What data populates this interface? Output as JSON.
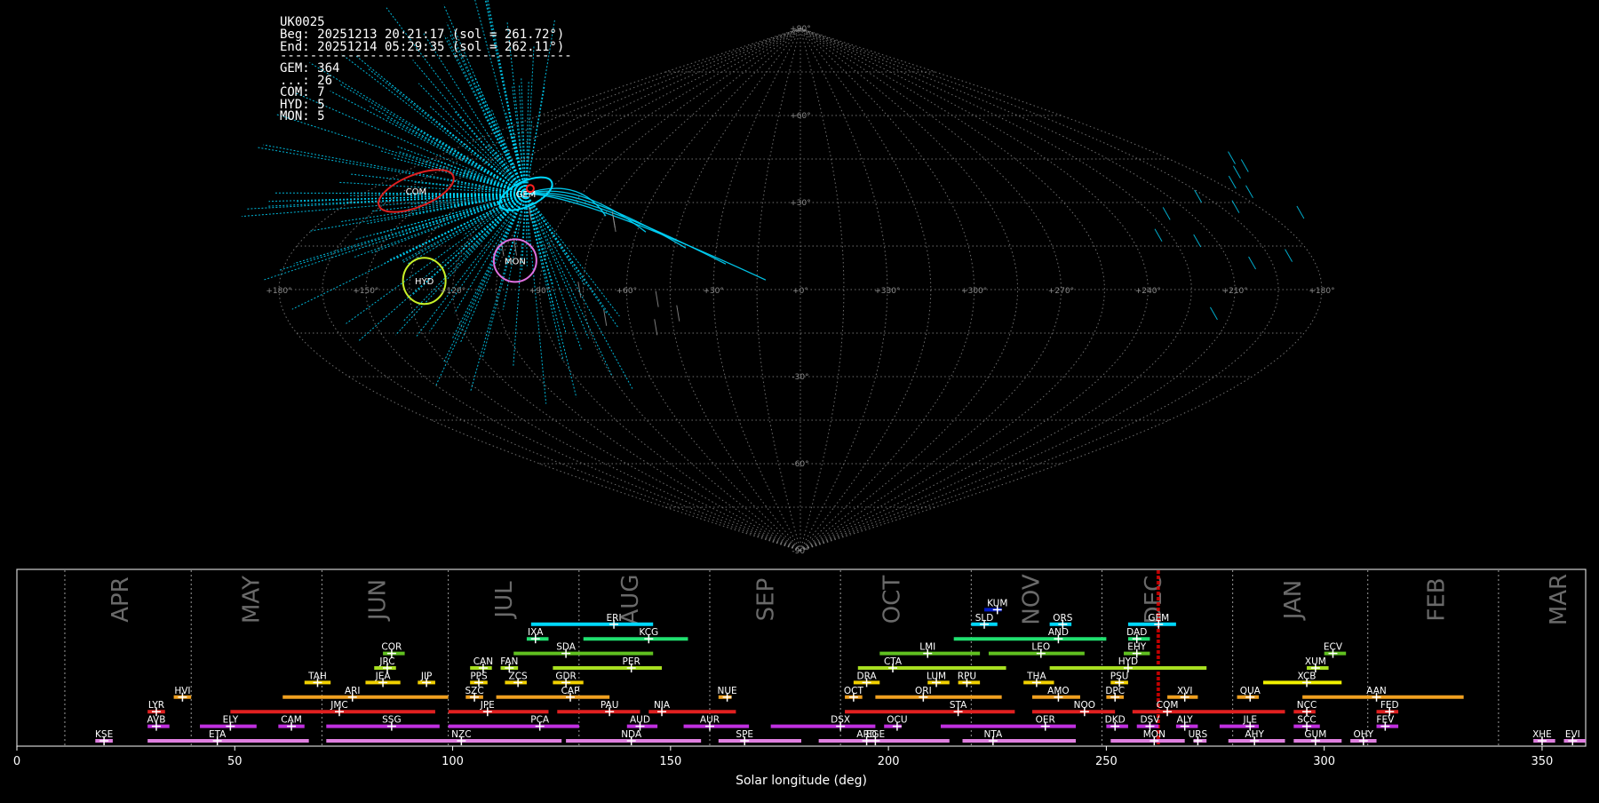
{
  "info": {
    "station": "UK0025",
    "beg": "Beg: 20251213 20:21:17 (sol = 261.72°)",
    "end": "End: 20251214 05:29:35 (sol = 262.11°)",
    "rule": "---------------------------------------",
    "counts": [
      "GEM: 364",
      "...: 26",
      "COM: 7",
      "HYD: 5",
      "MON: 5"
    ]
  },
  "sky_map": {
    "projection": "sinusoidal",
    "lon_ticks": [
      {
        "lon": 180,
        "label": "+180°"
      },
      {
        "lon": 150,
        "label": "+150°"
      },
      {
        "lon": 120,
        "label": "+120°"
      },
      {
        "lon": 90,
        "label": "+90°"
      },
      {
        "lon": 60,
        "label": "+60°"
      },
      {
        "lon": 30,
        "label": "+30°"
      },
      {
        "lon": 0,
        "label": "+0°"
      },
      {
        "lon": -30,
        "label": "+330°"
      },
      {
        "lon": -60,
        "label": "+300°"
      },
      {
        "lon": -90,
        "label": "+270°"
      },
      {
        "lon": -120,
        "label": "+240°"
      },
      {
        "lon": -150,
        "label": "+210°"
      },
      {
        "lon": -180,
        "label": "+180°"
      }
    ],
    "lat_ticks": [
      {
        "lat": 90,
        "label": "+90°"
      },
      {
        "lat": 60,
        "label": "+60°"
      },
      {
        "lat": 30,
        "label": "+30°"
      },
      {
        "lat": -30,
        "label": "-30°"
      },
      {
        "lat": -60,
        "label": "-60°"
      },
      {
        "lat": -90,
        "label": "-90°"
      }
    ],
    "radiants": [
      {
        "code": "GEM",
        "lon": 113,
        "lat": 33,
        "color": "#00d8ff"
      },
      {
        "code": "COM",
        "lon": 160,
        "lat": 34,
        "color": "#e02020"
      },
      {
        "code": "HYD",
        "lon": 130,
        "lat": 3,
        "color": "#c8f028"
      },
      {
        "code": "MON",
        "lon": 100,
        "lat": 10,
        "color": "#e070e0"
      }
    ],
    "colors": {
      "meteor": "#00d8ff",
      "grid": "#8a8a8a",
      "sporadic": "#9a9a9a",
      "flash": "#ff2020"
    }
  },
  "chart_data": {
    "type": "timeline",
    "xlabel": "Solar longitude (deg)",
    "xlim": [
      0,
      360
    ],
    "xticks": [
      0,
      50,
      100,
      150,
      200,
      250,
      300,
      350
    ],
    "month_boundaries": [
      11,
      40,
      70,
      99,
      129,
      159,
      189,
      219,
      249,
      279,
      310,
      340
    ],
    "months": [
      {
        "label": "APR",
        "sol": 24
      },
      {
        "label": "MAY",
        "sol": 54
      },
      {
        "label": "JUN",
        "sol": 83
      },
      {
        "label": "JUL",
        "sol": 112
      },
      {
        "label": "AUG",
        "sol": 141
      },
      {
        "label": "SEP",
        "sol": 172
      },
      {
        "label": "OCT",
        "sol": 201
      },
      {
        "label": "NOV",
        "sol": 233
      },
      {
        "label": "DEC",
        "sol": 261
      },
      {
        "label": "JAN",
        "sol": 293
      },
      {
        "label": "FEB",
        "sol": 326
      },
      {
        "label": "MAR",
        "sol": 354
      }
    ],
    "current_sol": [
      261.72,
      262.11
    ],
    "current_color": "#e00000",
    "showers": [
      {
        "code": "KUM",
        "start": 222,
        "end": 226,
        "peak": 225,
        "row": 10,
        "color": "#0018c8"
      },
      {
        "code": "ERI",
        "start": 118,
        "end": 146,
        "peak": 137,
        "row": 9,
        "color": "#00d8ff"
      },
      {
        "code": "SLD",
        "start": 219,
        "end": 225,
        "peak": 222,
        "row": 9,
        "color": "#00d8ff"
      },
      {
        "code": "ORS",
        "start": 237,
        "end": 242,
        "peak": 240,
        "row": 9,
        "color": "#00d8ff"
      },
      {
        "code": "GEM",
        "start": 255,
        "end": 266,
        "peak": 262,
        "row": 9,
        "color": "#00d8ff"
      },
      {
        "code": "IXA",
        "start": 117,
        "end": 122,
        "peak": 119,
        "row": 8,
        "color": "#20e070"
      },
      {
        "code": "KCG",
        "start": 130,
        "end": 154,
        "peak": 145,
        "row": 8,
        "color": "#20e070"
      },
      {
        "code": "AND",
        "start": 215,
        "end": 250,
        "peak": 239,
        "row": 8,
        "color": "#20e070"
      },
      {
        "code": "DAD",
        "start": 255,
        "end": 260,
        "peak": 257,
        "row": 8,
        "color": "#20e070"
      },
      {
        "code": "COR",
        "start": 84,
        "end": 89,
        "peak": 86,
        "row": 7,
        "color": "#60c020"
      },
      {
        "code": "SDA",
        "start": 114,
        "end": 146,
        "peak": 126,
        "row": 7,
        "color": "#60c020"
      },
      {
        "code": "LMI",
        "start": 198,
        "end": 221,
        "peak": 209,
        "row": 7,
        "color": "#60c020"
      },
      {
        "code": "LEO",
        "start": 223,
        "end": 245,
        "peak": 235,
        "row": 7,
        "color": "#60c020"
      },
      {
        "code": "EHY",
        "start": 254,
        "end": 260,
        "peak": 257,
        "row": 7,
        "color": "#60c020"
      },
      {
        "code": "ECV",
        "start": 300,
        "end": 305,
        "peak": 302,
        "row": 7,
        "color": "#60c020"
      },
      {
        "code": "JRC",
        "start": 82,
        "end": 87,
        "peak": 85,
        "row": 6,
        "color": "#a8e020"
      },
      {
        "code": "CAN",
        "start": 104,
        "end": 109,
        "peak": 107,
        "row": 6,
        "color": "#a8e020"
      },
      {
        "code": "FAN",
        "start": 111,
        "end": 115,
        "peak": 113,
        "row": 6,
        "color": "#a8e020"
      },
      {
        "code": "PER",
        "start": 123,
        "end": 148,
        "peak": 141,
        "row": 6,
        "color": "#a8e020"
      },
      {
        "code": "CTA",
        "start": 193,
        "end": 227,
        "peak": 201,
        "row": 6,
        "color": "#a8e020"
      },
      {
        "code": "HYD",
        "start": 237,
        "end": 273,
        "peak": 255,
        "row": 6,
        "color": "#a8e020"
      },
      {
        "code": "XUM",
        "start": 296,
        "end": 301,
        "peak": 298,
        "row": 6,
        "color": "#a8e020"
      },
      {
        "code": "TAH",
        "start": 66,
        "end": 72,
        "peak": 69,
        "row": 5,
        "color": "#f0d000"
      },
      {
        "code": "JEA",
        "start": 80,
        "end": 88,
        "peak": 84,
        "row": 5,
        "color": "#f0d000"
      },
      {
        "code": "JIP",
        "start": 92,
        "end": 96,
        "peak": 94,
        "row": 5,
        "color": "#f0d000"
      },
      {
        "code": "PPS",
        "start": 104,
        "end": 108,
        "peak": 106,
        "row": 5,
        "color": "#f0d000"
      },
      {
        "code": "ZCS",
        "start": 112,
        "end": 117,
        "peak": 115,
        "row": 5,
        "color": "#f0d000"
      },
      {
        "code": "GDR",
        "start": 123,
        "end": 130,
        "peak": 126,
        "row": 5,
        "color": "#f0d000"
      },
      {
        "code": "DRA",
        "start": 192,
        "end": 198,
        "peak": 195,
        "row": 5,
        "color": "#f0d000"
      },
      {
        "code": "LUM",
        "start": 209,
        "end": 214,
        "peak": 211,
        "row": 5,
        "color": "#f0d000"
      },
      {
        "code": "RPU",
        "start": 216,
        "end": 221,
        "peak": 218,
        "row": 5,
        "color": "#f0d000"
      },
      {
        "code": "THA",
        "start": 231,
        "end": 238,
        "peak": 234,
        "row": 5,
        "color": "#f0d000"
      },
      {
        "code": "PSU",
        "start": 251,
        "end": 255,
        "peak": 253,
        "row": 5,
        "color": "#f0d000"
      },
      {
        "code": "XCB",
        "start": 286,
        "end": 304,
        "peak": 296,
        "row": 5,
        "color": "#f0f000"
      },
      {
        "code": "HVI",
        "start": 36,
        "end": 40,
        "peak": 38,
        "row": 4,
        "color": "#f0a020"
      },
      {
        "code": "ARI",
        "start": 61,
        "end": 99,
        "peak": 77,
        "row": 4,
        "color": "#f0a020"
      },
      {
        "code": "SZC",
        "start": 103,
        "end": 107,
        "peak": 105,
        "row": 4,
        "color": "#f0a020"
      },
      {
        "code": "CAP",
        "start": 110,
        "end": 136,
        "peak": 127,
        "row": 4,
        "color": "#f0a020"
      },
      {
        "code": "NUE",
        "start": 161,
        "end": 164,
        "peak": 163,
        "row": 4,
        "color": "#f0a020"
      },
      {
        "code": "OCT",
        "start": 190,
        "end": 194,
        "peak": 192,
        "row": 4,
        "color": "#f0a020"
      },
      {
        "code": "ORI",
        "start": 197,
        "end": 226,
        "peak": 208,
        "row": 4,
        "color": "#f0a020"
      },
      {
        "code": "AMO",
        "start": 233,
        "end": 244,
        "peak": 239,
        "row": 4,
        "color": "#f0a020"
      },
      {
        "code": "DPC",
        "start": 250,
        "end": 254,
        "peak": 252,
        "row": 4,
        "color": "#f0a020"
      },
      {
        "code": "XVI",
        "start": 264,
        "end": 271,
        "peak": 268,
        "row": 4,
        "color": "#f0a020"
      },
      {
        "code": "QUA",
        "start": 280,
        "end": 285,
        "peak": 283,
        "row": 4,
        "color": "#f0a020"
      },
      {
        "code": "AAN",
        "start": 295,
        "end": 332,
        "peak": 312,
        "row": 4,
        "color": "#f0a020"
      },
      {
        "code": "LYR",
        "start": 30,
        "end": 34,
        "peak": 32,
        "row": 3,
        "color": "#e02020"
      },
      {
        "code": "JMC",
        "start": 49,
        "end": 96,
        "peak": 74,
        "row": 3,
        "color": "#e02020"
      },
      {
        "code": "JPE",
        "start": 99,
        "end": 122,
        "peak": 108,
        "row": 3,
        "color": "#e02020"
      },
      {
        "code": "PAU",
        "start": 124,
        "end": 143,
        "peak": 136,
        "row": 3,
        "color": "#e02020"
      },
      {
        "code": "NIA",
        "start": 145,
        "end": 165,
        "peak": 148,
        "row": 3,
        "color": "#e02020"
      },
      {
        "code": "STA",
        "start": 190,
        "end": 229,
        "peak": 216,
        "row": 3,
        "color": "#e02020"
      },
      {
        "code": "NOO",
        "start": 233,
        "end": 252,
        "peak": 245,
        "row": 3,
        "color": "#e02020"
      },
      {
        "code": "COM",
        "start": 256,
        "end": 291,
        "peak": 264,
        "row": 3,
        "color": "#e02020"
      },
      {
        "code": "NCC",
        "start": 293,
        "end": 298,
        "peak": 296,
        "row": 3,
        "color": "#e02020"
      },
      {
        "code": "FED",
        "start": 312,
        "end": 317,
        "peak": 315,
        "row": 3,
        "color": "#e02020"
      },
      {
        "code": "AVB",
        "start": 30,
        "end": 35,
        "peak": 32,
        "row": 2,
        "color": "#c030e0"
      },
      {
        "code": "ELY",
        "start": 42,
        "end": 55,
        "peak": 49,
        "row": 2,
        "color": "#c030e0"
      },
      {
        "code": "CAM",
        "start": 60,
        "end": 66,
        "peak": 63,
        "row": 2,
        "color": "#c030e0"
      },
      {
        "code": "SSG",
        "start": 71,
        "end": 97,
        "peak": 86,
        "row": 2,
        "color": "#c030e0"
      },
      {
        "code": "PCA",
        "start": 99,
        "end": 129,
        "peak": 120,
        "row": 2,
        "color": "#c030e0"
      },
      {
        "code": "AUD",
        "start": 140,
        "end": 147,
        "peak": 143,
        "row": 2,
        "color": "#c030e0"
      },
      {
        "code": "AUR",
        "start": 153,
        "end": 168,
        "peak": 159,
        "row": 2,
        "color": "#c030e0"
      },
      {
        "code": "DSX",
        "start": 173,
        "end": 197,
        "peak": 189,
        "row": 2,
        "color": "#c030e0"
      },
      {
        "code": "OCU",
        "start": 199,
        "end": 203,
        "peak": 202,
        "row": 2,
        "color": "#c030e0"
      },
      {
        "code": "OER",
        "start": 212,
        "end": 243,
        "peak": 236,
        "row": 2,
        "color": "#c030e0"
      },
      {
        "code": "DKD",
        "start": 250,
        "end": 255,
        "peak": 252,
        "row": 2,
        "color": "#c030e0"
      },
      {
        "code": "DSV",
        "start": 257,
        "end": 262,
        "peak": 260,
        "row": 2,
        "color": "#c030e0"
      },
      {
        "code": "ALY",
        "start": 266,
        "end": 271,
        "peak": 268,
        "row": 2,
        "color": "#c030e0"
      },
      {
        "code": "JLE",
        "start": 276,
        "end": 285,
        "peak": 283,
        "row": 2,
        "color": "#c030e0"
      },
      {
        "code": "SCC",
        "start": 293,
        "end": 299,
        "peak": 296,
        "row": 2,
        "color": "#c030e0"
      },
      {
        "code": "FEV",
        "start": 312,
        "end": 317,
        "peak": 314,
        "row": 2,
        "color": "#c030e0"
      },
      {
        "code": "KSE",
        "start": 18,
        "end": 22,
        "peak": 20,
        "row": 1,
        "color": "#e080e0"
      },
      {
        "code": "ETA",
        "start": 30,
        "end": 67,
        "peak": 46,
        "row": 1,
        "color": "#e080e0"
      },
      {
        "code": "NZC",
        "start": 71,
        "end": 125,
        "peak": 102,
        "row": 1,
        "color": "#e080e0"
      },
      {
        "code": "NDA",
        "start": 126,
        "end": 157,
        "peak": 141,
        "row": 1,
        "color": "#e080e0"
      },
      {
        "code": "SPE",
        "start": 161,
        "end": 180,
        "peak": 167,
        "row": 1,
        "color": "#e080e0"
      },
      {
        "code": "ARD",
        "start": 184,
        "end": 198,
        "peak": 195,
        "row": 1,
        "color": "#e080e0"
      },
      {
        "code": "EGE",
        "start": 196,
        "end": 214,
        "peak": 197,
        "row": 1,
        "color": "#e080e0"
      },
      {
        "code": "NTA",
        "start": 217,
        "end": 243,
        "peak": 224,
        "row": 1,
        "color": "#e080e0"
      },
      {
        "code": "MON",
        "start": 251,
        "end": 268,
        "peak": 261,
        "row": 1,
        "color": "#e080e0"
      },
      {
        "code": "URS",
        "start": 270,
        "end": 273,
        "peak": 271,
        "row": 1,
        "color": "#e080e0"
      },
      {
        "code": "AHY",
        "start": 278,
        "end": 291,
        "peak": 284,
        "row": 1,
        "color": "#e080e0"
      },
      {
        "code": "GUM",
        "start": 293,
        "end": 304,
        "peak": 298,
        "row": 1,
        "color": "#e080e0"
      },
      {
        "code": "OHY",
        "start": 306,
        "end": 312,
        "peak": 309,
        "row": 1,
        "color": "#e080e0"
      },
      {
        "code": "XHE",
        "start": 348,
        "end": 353,
        "peak": 350,
        "row": 1,
        "color": "#e080e0"
      },
      {
        "code": "EVI",
        "start": 355,
        "end": 360,
        "peak": 357,
        "row": 1,
        "color": "#e080e0"
      }
    ]
  }
}
